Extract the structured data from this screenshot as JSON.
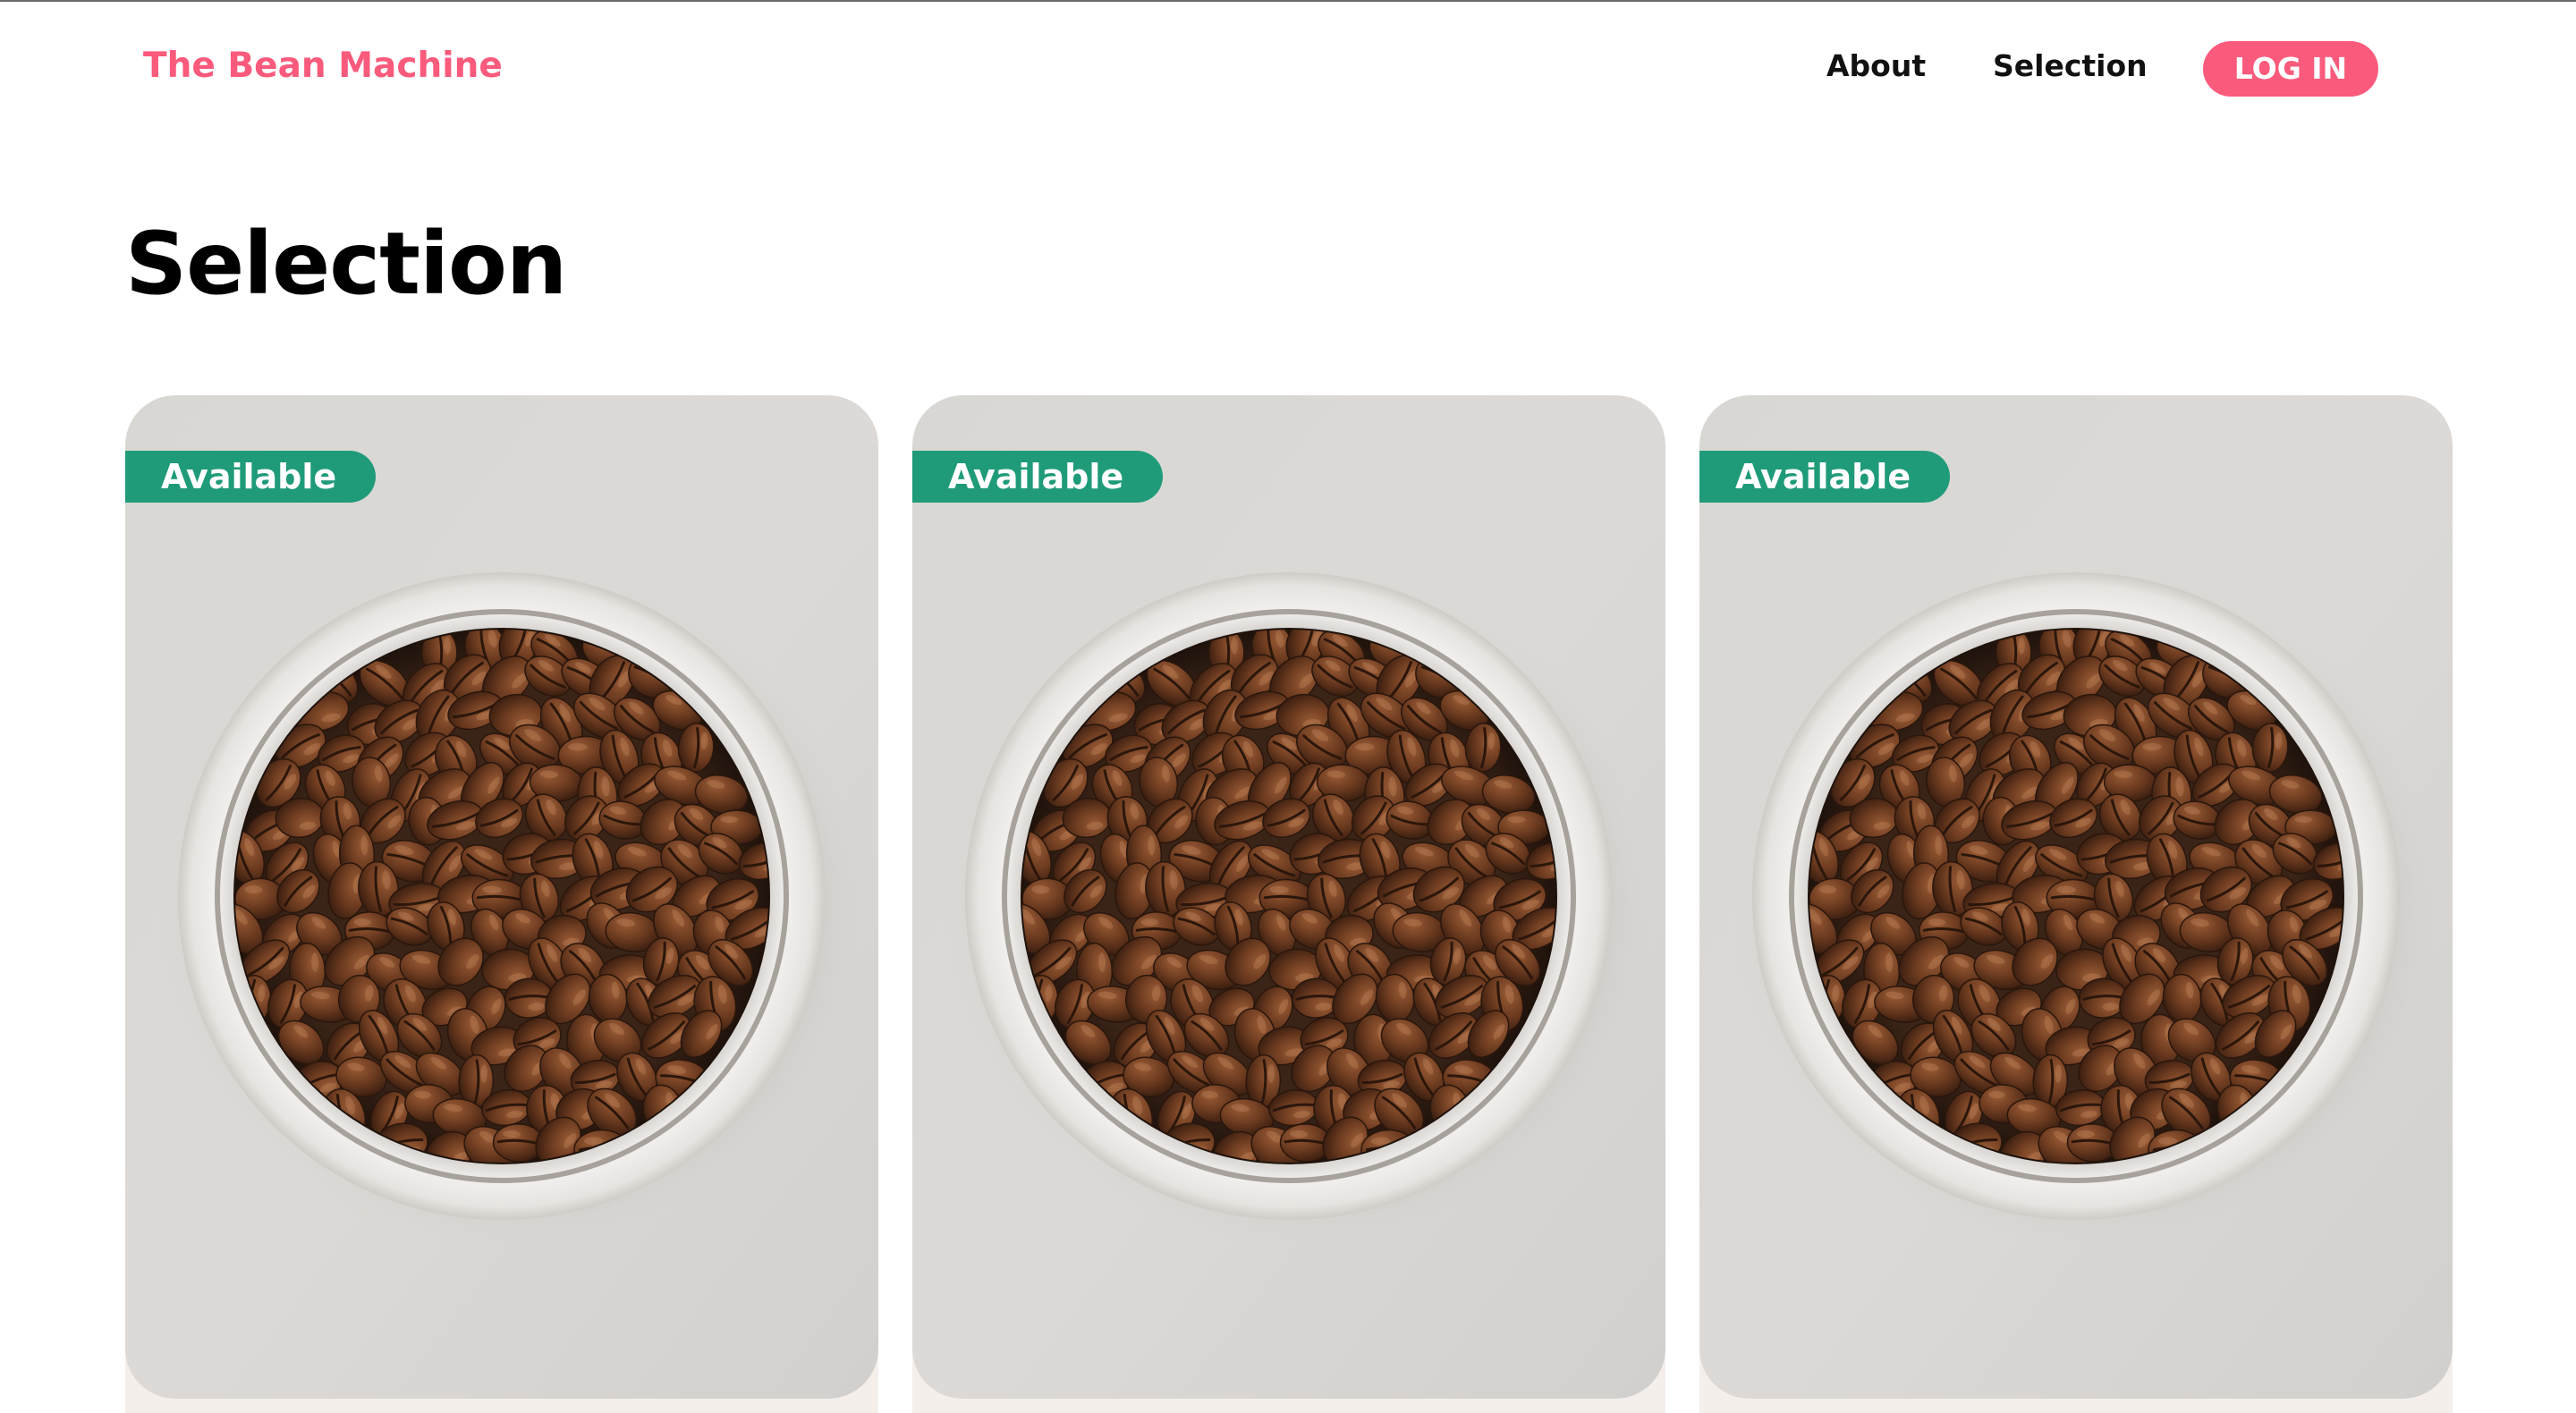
{
  "navbar": {
    "brand": "The Bean Machine",
    "links": [
      {
        "label": "About"
      },
      {
        "label": "Selection"
      }
    ],
    "login_label": "LOG IN"
  },
  "main": {
    "title": "Selection",
    "products": [
      {
        "badge": "Available",
        "image": "coffee-beans-bowl"
      },
      {
        "badge": "Available",
        "image": "coffee-beans-bowl"
      },
      {
        "badge": "Available",
        "image": "coffee-beans-bowl"
      }
    ]
  },
  "colors": {
    "brand": "#fa5a7c",
    "badge": "#1f9b79",
    "text": "#111111"
  }
}
